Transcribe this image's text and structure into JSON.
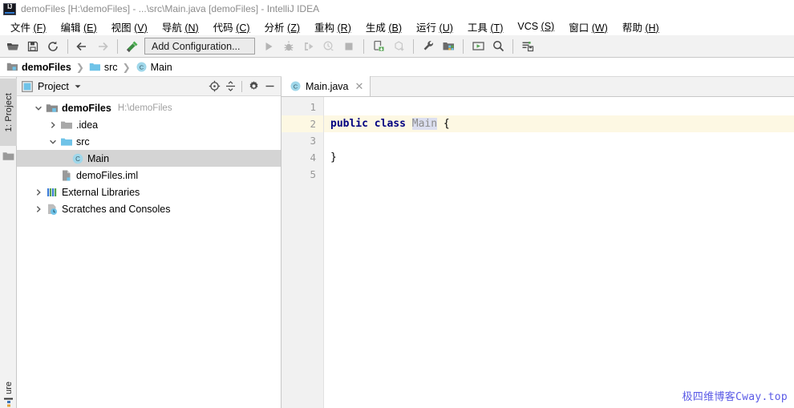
{
  "window": {
    "title": "demoFiles [H:\\demoFiles] - ...\\src\\Main.java [demoFiles] - IntelliJ IDEA",
    "app_icon": "intellij-idea-logo"
  },
  "menubar": {
    "items": [
      {
        "label": "文件",
        "accelerator": "(F)"
      },
      {
        "label": "编辑",
        "accelerator": "(E)"
      },
      {
        "label": "视图",
        "accelerator": "(V)"
      },
      {
        "label": "导航",
        "accelerator": "(N)"
      },
      {
        "label": "代码",
        "accelerator": "(C)"
      },
      {
        "label": "分析",
        "accelerator": "(Z)"
      },
      {
        "label": "重构",
        "accelerator": "(R)"
      },
      {
        "label": "生成",
        "accelerator": "(B)"
      },
      {
        "label": "运行",
        "accelerator": "(U)"
      },
      {
        "label": "工具",
        "accelerator": "(T)"
      },
      {
        "label": "VCS",
        "accelerator": "(S)"
      },
      {
        "label": "窗口",
        "accelerator": "(W)"
      },
      {
        "label": "帮助",
        "accelerator": "(H)"
      }
    ]
  },
  "toolbar": {
    "open_icon": "open-folder-icon",
    "save_icon": "save-icon",
    "sync_icon": "sync-icon",
    "back_icon": "arrow-left-icon",
    "forward_icon": "arrow-right-icon",
    "build_icon": "hammer-build-icon",
    "run_config_label": "Add Configuration...",
    "run_icon": "run-play-icon",
    "debug_icon": "debug-bug-icon",
    "coverage_icon": "run-with-coverage-icon",
    "profile_icon": "profile-icon",
    "stop_icon": "stop-square-icon",
    "vcs_update_icon": "vcs-update-icon",
    "vcs_push_icon": "vcs-push-icon",
    "settings_icon": "wrench-settings-icon",
    "project_structure_icon": "project-structure-icon",
    "run_anything_icon": "run-anything-icon",
    "search_icon": "search-everywhere-icon",
    "commit_icon": "vcs-commit-icon"
  },
  "breadcrumb": {
    "items": [
      {
        "label": "demoFiles",
        "icon": "module-icon",
        "bold": true
      },
      {
        "label": "src",
        "icon": "source-folder-icon",
        "bold": false
      },
      {
        "label": "Main",
        "icon": "java-class-icon",
        "bold": false
      }
    ],
    "separator": "❯"
  },
  "left_strip": {
    "project_tab_label": "1: Project",
    "project_tab_icon": "project-folder-icon",
    "structure_tab_label": "ure",
    "structure_tab_icon": "structure-icon"
  },
  "project_panel": {
    "title": "Project",
    "title_icon": "project-view-icon",
    "dropdown_icon": "chevron-down-icon",
    "locate_icon": "scroll-from-source-icon",
    "collapse_icon": "collapse-all-icon",
    "settings_icon": "gear-icon",
    "hide_icon": "hide-panel-icon",
    "tree": [
      {
        "label": "demoFiles",
        "secondary": "H:\\demoFiles",
        "icon": "module-icon",
        "indent": 0,
        "twisty": "expanded",
        "bold": true,
        "selected": false
      },
      {
        "label": ".idea",
        "secondary": "",
        "icon": "folder-icon",
        "indent": 1,
        "twisty": "collapsed",
        "bold": false,
        "selected": false
      },
      {
        "label": "src",
        "secondary": "",
        "icon": "source-folder-icon",
        "indent": 1,
        "twisty": "expanded",
        "bold": false,
        "selected": false
      },
      {
        "label": "Main",
        "secondary": "",
        "icon": "java-class-icon",
        "indent": 2,
        "twisty": "none",
        "bold": false,
        "selected": true
      },
      {
        "label": "demoFiles.iml",
        "secondary": "",
        "icon": "iml-file-icon",
        "indent": 1,
        "twisty": "none",
        "bold": false,
        "selected": false
      },
      {
        "label": "External Libraries",
        "secondary": "",
        "icon": "libraries-icon",
        "indent": 0,
        "twisty": "collapsed",
        "bold": false,
        "selected": false
      },
      {
        "label": "Scratches and Consoles",
        "secondary": "",
        "icon": "scratches-icon",
        "indent": 0,
        "twisty": "collapsed",
        "bold": false,
        "selected": false
      }
    ]
  },
  "editor": {
    "tab": {
      "label": "Main.java",
      "icon": "java-class-icon",
      "close": "✕"
    },
    "line_numbers": [
      "1",
      "2",
      "3",
      "4",
      "5"
    ],
    "caret_line": 2,
    "lines": [
      {
        "n": 1,
        "tokens": []
      },
      {
        "n": 2,
        "tokens": [
          {
            "text": "public",
            "type": "keyword"
          },
          {
            "text": " ",
            "type": "plain"
          },
          {
            "text": "class",
            "type": "keyword"
          },
          {
            "text": " ",
            "type": "plain"
          },
          {
            "text": "Main",
            "type": "class-name-highlighted"
          },
          {
            "text": " ",
            "type": "plain"
          },
          {
            "text": "{",
            "type": "brace"
          }
        ]
      },
      {
        "n": 3,
        "tokens": []
      },
      {
        "n": 4,
        "tokens": [
          {
            "text": "}",
            "type": "brace"
          }
        ]
      },
      {
        "n": 5,
        "tokens": []
      }
    ]
  },
  "watermark": {
    "text": "极四维博客Cway.top"
  },
  "colors": {
    "keyword": "#000080",
    "class_name": "#8c8c8c",
    "class_name_bg": "#dcdff0",
    "caret_line_bg": "#fdf8e3",
    "selection_bg": "#d4d4d4",
    "toolbar_bg": "#f2f2f2",
    "folder_blue": "#6fc3e8",
    "watermark": "#5a5ae6"
  }
}
